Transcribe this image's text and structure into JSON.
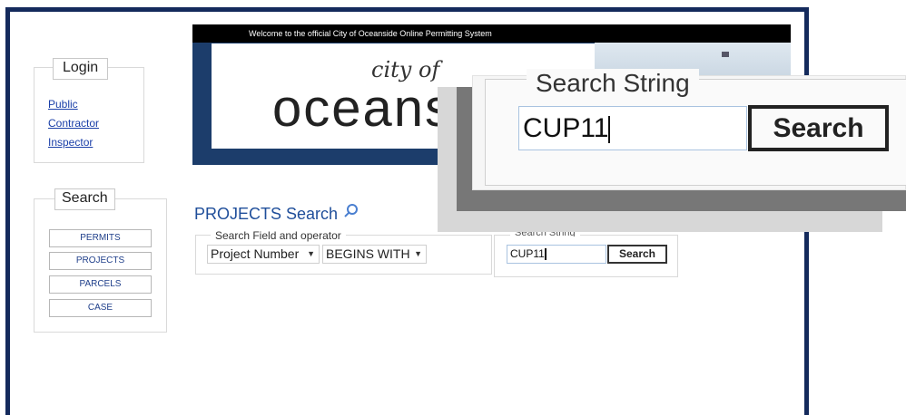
{
  "banner": {
    "welcome_text": "Welcome to the official City of Oceanside Online Permitting System",
    "logo_line1": "city of",
    "logo_line2": "oceans"
  },
  "login": {
    "legend": "Login",
    "links": [
      "Public",
      "Contractor",
      "Inspector"
    ]
  },
  "search_panel": {
    "legend": "Search",
    "buttons": [
      "PERMITS",
      "PROJECTS",
      "PARCELS",
      "CASE"
    ]
  },
  "main": {
    "title": "PROJECTS Search",
    "field_group_legend": "Search Field and operator",
    "field_value": "Project Number",
    "operator_value": "BEGINS WITH",
    "search_string_legend": "Search String",
    "search_string_value": "CUP11",
    "search_button": "Search"
  },
  "zoom": {
    "legend": "Search String",
    "input_value": "CUP11",
    "button": "Search"
  },
  "colors": {
    "frame": "#142a5c",
    "link": "#1a3fa8",
    "title": "#1f4e9a"
  }
}
